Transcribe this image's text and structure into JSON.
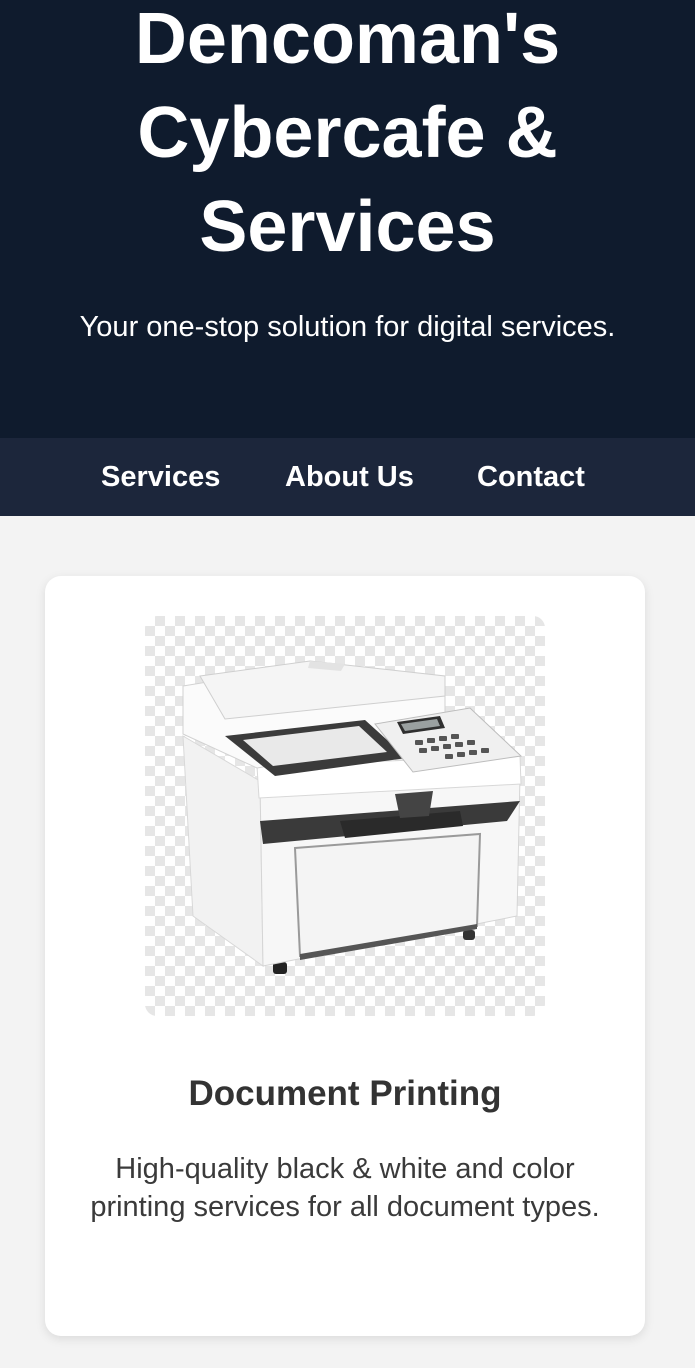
{
  "hero": {
    "title": "Dencoman's Cybercafe & Services",
    "tagline": "Your one-stop solution for digital services."
  },
  "nav": {
    "items": [
      {
        "label": "Services"
      },
      {
        "label": "About Us"
      },
      {
        "label": "Contact"
      }
    ]
  },
  "services": {
    "cards": [
      {
        "image_icon": "printer-image",
        "title": "Document Printing",
        "description": "High-quality black & white and color printing services for all document types."
      }
    ]
  },
  "colors": {
    "hero_background": "#0f1b2d",
    "nav_background": "#1c263b",
    "page_background": "#f3f3f3",
    "card_background": "#ffffff",
    "heading_text": "#333333"
  }
}
